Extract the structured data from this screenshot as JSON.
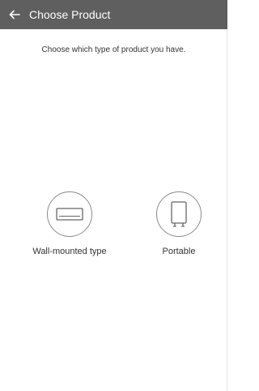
{
  "header": {
    "title": "Choose Product",
    "back_icon": "arrow-left-icon",
    "bg_color": "#5f5f5f"
  },
  "subtitle": "Choose which type of product you have.",
  "options": [
    {
      "label": "Wall-mounted type",
      "icon": "wall-mounted-ac-icon"
    },
    {
      "label": "Portable",
      "icon": "portable-ac-icon"
    }
  ]
}
